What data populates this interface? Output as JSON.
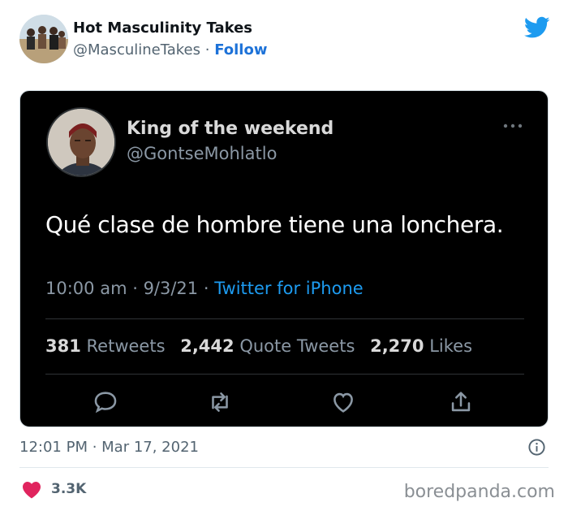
{
  "outer_tweet": {
    "display_name": "Hot Masculinity Takes",
    "handle": "@MasculineTakes",
    "separator": " · ",
    "follow_label": "Follow",
    "timestamp": "12:01 PM · Mar 17, 2021",
    "like_count": "3.3K"
  },
  "embedded_tweet": {
    "display_name": "King of the weekend",
    "handle": "@GontseMohlatlo",
    "text": "Qué clase de hombre tiene una lonchera.",
    "time": "10:00 am",
    "date": "9/3/21",
    "separator": " · ",
    "source": "Twitter for iPhone",
    "stats": {
      "retweets_count": "381",
      "retweets_label": "Retweets",
      "quote_count": "2,442",
      "quote_label": "Quote Tweets",
      "likes_count": "2,270",
      "likes_label": "Likes"
    },
    "actions": [
      "reply-icon",
      "retweet-icon",
      "like-icon",
      "share-icon"
    ]
  },
  "watermark": "boredpanda.com",
  "colors": {
    "twitter_blue": "#1d9bf0",
    "heart_red": "#e0245e",
    "dark_card": "#000000"
  }
}
